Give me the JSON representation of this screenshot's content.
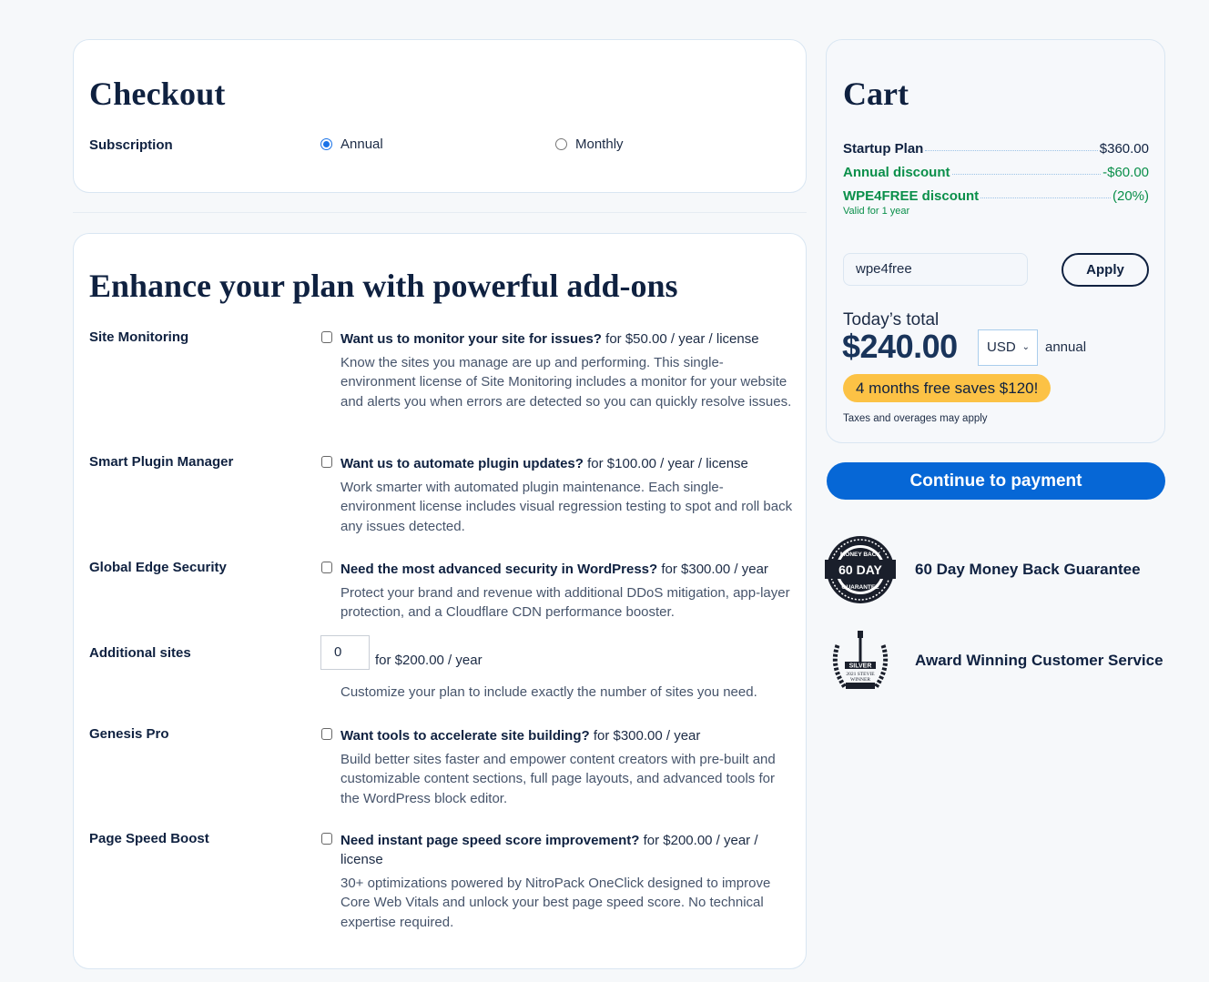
{
  "checkout": {
    "title": "Checkout",
    "subscription_label": "Subscription",
    "options": [
      {
        "label": "Annual",
        "selected": true
      },
      {
        "label": "Monthly",
        "selected": false
      }
    ]
  },
  "addons": {
    "title": "Enhance your plan with powerful add-ons",
    "items": [
      {
        "name": "Site Monitoring",
        "question": "Want us to monitor your site for issues?",
        "price": " for $50.00 / year / license",
        "description": "Know the sites you manage are up and performing. This single-environment license of Site Monitoring includes a monitor for your website and alerts you when errors are detected so you can quickly resolve issues.",
        "checked": false
      },
      {
        "name": "Smart Plugin Manager",
        "question": "Want us to automate plugin updates?",
        "price": " for $100.00 / year / license",
        "description": "Work smarter with automated plugin maintenance. Each single-environment license includes visual regression testing to spot and roll back any issues detected.",
        "checked": false
      },
      {
        "name": "Global Edge Security",
        "question": "Need the most advanced security in WordPress?",
        "price": " for $300.00 / year",
        "description": "Protect your brand and revenue with additional DDoS mitigation, app-layer protection, and a Cloudflare CDN performance booster.",
        "checked": false
      },
      {
        "name": "Genesis Pro",
        "question": "Want tools to accelerate site building?",
        "price": " for $300.00 / year",
        "description": "Build better sites faster and empower content creators with pre-built and customizable content sections, full page layouts, and advanced tools for the WordPress block editor.",
        "checked": false
      },
      {
        "name": "Page Speed Boost",
        "question": "Need instant page speed score improvement?",
        "price": " for $200.00 / year / license",
        "description": "30+ optimizations powered by NitroPack OneClick designed to improve Core Web Vitals and unlock your best page speed score. No technical expertise required.",
        "checked": false
      }
    ],
    "additional_sites": {
      "name": "Additional sites",
      "quantity": "0",
      "price": "for $200.00 / year",
      "description": "Customize your plan to include exactly the number of sites you need."
    }
  },
  "cart": {
    "title": "Cart",
    "lines": [
      {
        "label": "Startup Plan",
        "value": "$360.00"
      },
      {
        "label": "Annual discount",
        "value": "-$60.00"
      },
      {
        "label": "WPE4FREE discount",
        "value": "(20%)"
      }
    ],
    "discount_note": "Valid for 1 year",
    "promo_code": "wpe4free",
    "apply_label": "Apply",
    "total_label": "Today’s total",
    "total": "$240.00",
    "currency": "USD",
    "period": "annual",
    "savings": "4 months free saves $120!",
    "taxes_note": "Taxes and overages may apply",
    "continue_label": "Continue to payment"
  },
  "badges": [
    {
      "icon": "money-back-guarantee-icon",
      "icon_text": [
        "MONEY BACK",
        "60 DAY",
        "GUARANTEE"
      ],
      "label": "60 Day Money Back Guarantee"
    },
    {
      "icon": "stevie-award-icon",
      "icon_text": [
        "SILVER",
        "2021 STEVIE",
        "WINNER"
      ],
      "label": "Award Winning Customer Service"
    }
  ],
  "colors": {
    "primary": "#0667d6",
    "discount": "#0a8f4a",
    "savings": "#fcc245",
    "heading": "#0e2246"
  }
}
